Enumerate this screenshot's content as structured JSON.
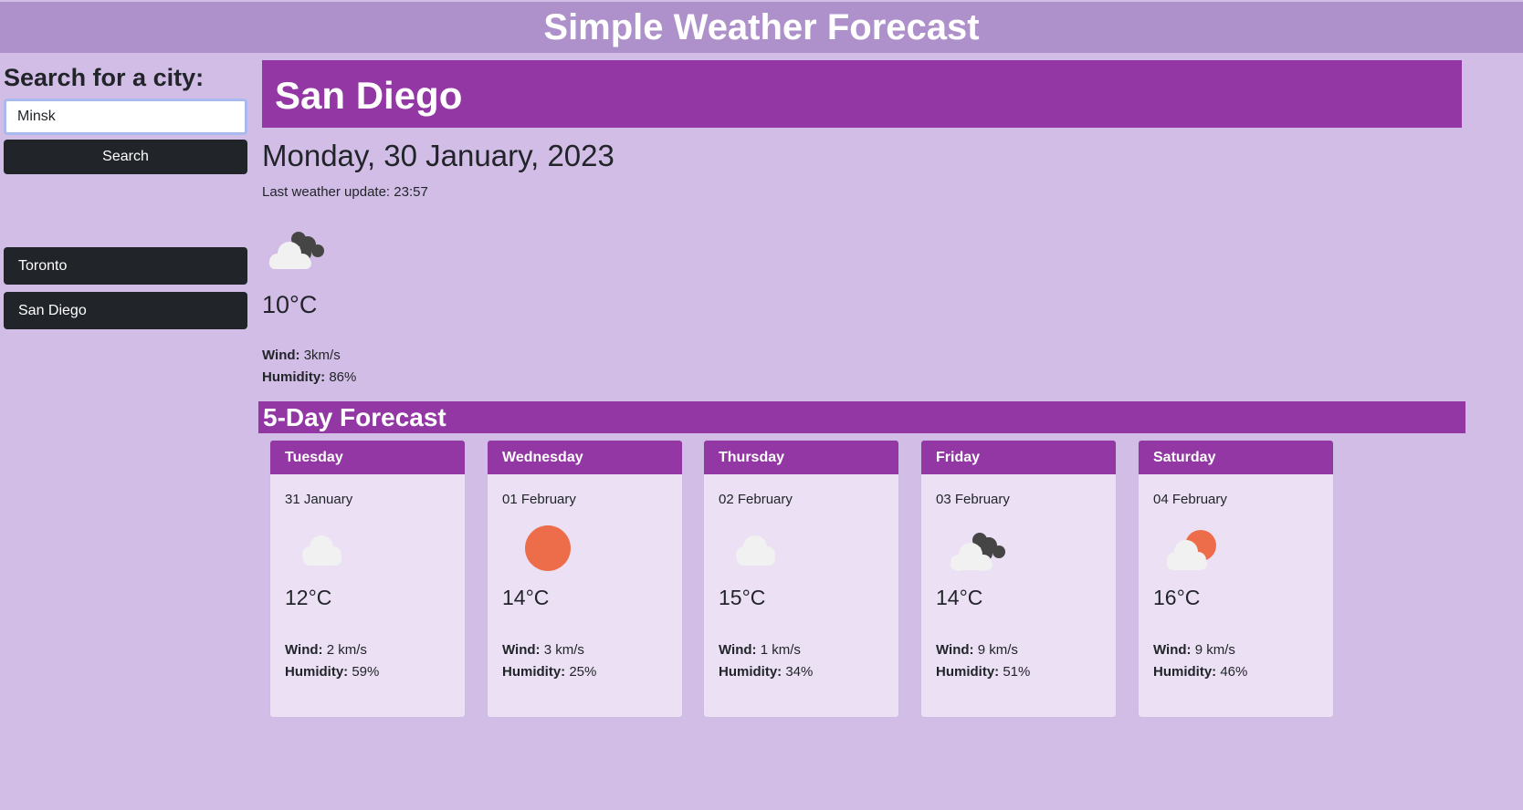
{
  "header": {
    "title": "Simple Weather Forecast"
  },
  "sidebar": {
    "search_heading": "Search for a city:",
    "search_value": "Minsk",
    "search_button": "Search",
    "history": [
      "Toronto",
      "San Diego"
    ]
  },
  "current": {
    "city": "San Diego",
    "date": "Monday, 30 January, 2023",
    "last_update": "Last weather update: 23:57",
    "icon": "cloudy-dark-icon",
    "temp": "10°C",
    "wind_label": "Wind:",
    "wind": "3km/s",
    "humidity_label": "Humidity:",
    "humidity": "86%"
  },
  "forecast": {
    "heading": "5-Day Forecast",
    "wind_label": "Wind:",
    "humidity_label": "Humidity:",
    "days": [
      {
        "day": "Tuesday",
        "date": "31 January",
        "icon": "cloud-icon",
        "temp": "12°C",
        "wind": "2 km/s",
        "humidity": "59%"
      },
      {
        "day": "Wednesday",
        "date": "01 February",
        "icon": "sun-icon",
        "temp": "14°C",
        "wind": "3 km/s",
        "humidity": "25%"
      },
      {
        "day": "Thursday",
        "date": "02 February",
        "icon": "cloud-icon",
        "temp": "15°C",
        "wind": "1 km/s",
        "humidity": "34%"
      },
      {
        "day": "Friday",
        "date": "03 February",
        "icon": "cloudy-dark-icon",
        "temp": "14°C",
        "wind": "9 km/s",
        "humidity": "51%"
      },
      {
        "day": "Saturday",
        "date": "04 February",
        "icon": "partly-cloudy-icon",
        "temp": "16°C",
        "wind": "9 km/s",
        "humidity": "46%"
      }
    ]
  },
  "colors": {
    "background": "#d2bde6",
    "header": "#ae91cb",
    "accent": "#9237a3",
    "card": "#ece0f5",
    "button": "#212529",
    "sun": "#ed6d4a",
    "cloud_light": "#f1f1f1",
    "cloud_dark": "#454545"
  }
}
